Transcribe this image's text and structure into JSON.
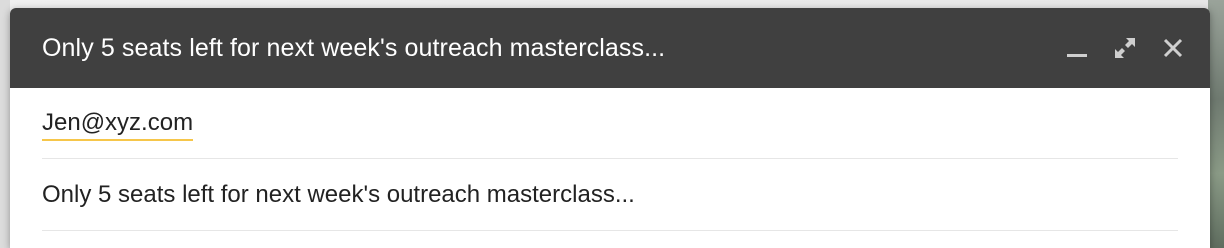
{
  "window": {
    "title": "Only 5 seats left for next week's outreach masterclass..."
  },
  "controls": [
    {
      "name": "minimize-icon"
    },
    {
      "name": "expand-icon"
    },
    {
      "name": "close-icon"
    }
  ],
  "recipients": {
    "to": "Jen@xyz.com"
  },
  "subject": {
    "value": "Only 5 seats left for next week's outreach masterclass..."
  },
  "colors": {
    "title_bar": "#404040",
    "recipient_underline": "#f6c64a"
  }
}
